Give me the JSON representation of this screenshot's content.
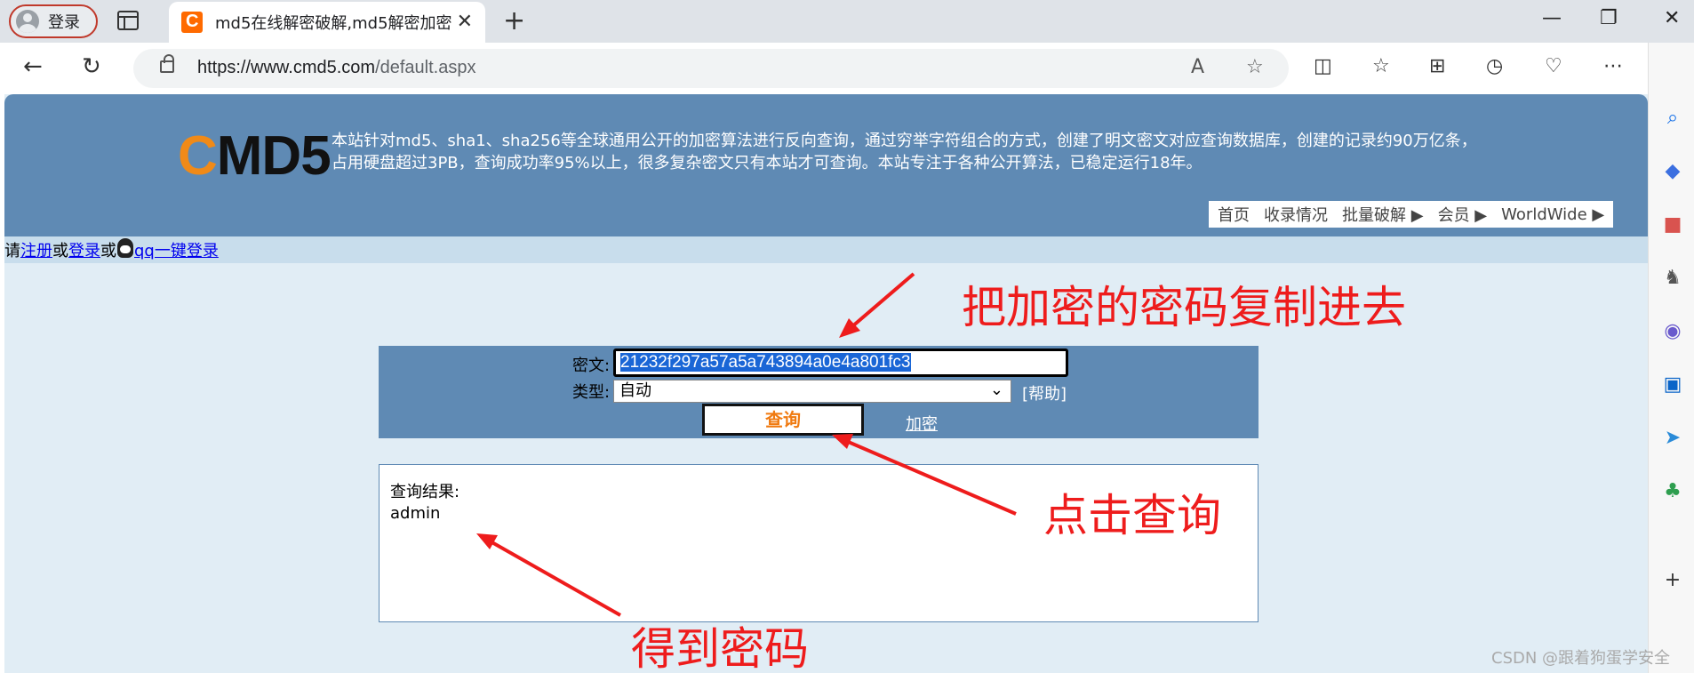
{
  "browser": {
    "profile_label": "登录",
    "tab_title": "md5在线解密破解,md5解密加密",
    "tab_close": "✕",
    "new_tab": "+",
    "url_host": "https://www.cmd5.com",
    "url_path": "/default.aspx",
    "minimize": "—",
    "restore": "❐",
    "close": "✕"
  },
  "site": {
    "logo_c": "C",
    "logo_rest": "MD5",
    "description": "本站针对md5、sha1、sha256等全球通用公开的加密算法进行反向查询，通过穷举字符组合的方式，创建了明文密文对应查询数据库，创建的记录约90万亿条，占用硬盘超过3PB，查询成功率95%以上，很多复杂密文只有本站才可查询。本站专注于各种公开算法，已稳定运行18年。",
    "nav": [
      "首页",
      "收录情况",
      "批量破解 ▶",
      "会员 ▶",
      "WorldWide ▶"
    ]
  },
  "loginbar": {
    "prefix": "请",
    "register": "注册",
    "or1": "或",
    "login": "登录",
    "or2": "或",
    "qq_login": "qq一键登录"
  },
  "form": {
    "cipher_label": "密文:",
    "cipher_value": "21232f297a57a5a743894a0e4a801fc3",
    "type_label": "类型:",
    "type_value": "自动",
    "help": "[帮助]",
    "query_button": "查询",
    "encrypt_link": "加密"
  },
  "result": {
    "title": "查询结果:",
    "value": "admin"
  },
  "annotations": {
    "copy_hint": "把加密的密码复制进去",
    "click_hint": "点击查询",
    "result_hint": "得到密码",
    "color": "#ee1c1c"
  },
  "watermark": "CSDN @跟着狗蛋学安全"
}
